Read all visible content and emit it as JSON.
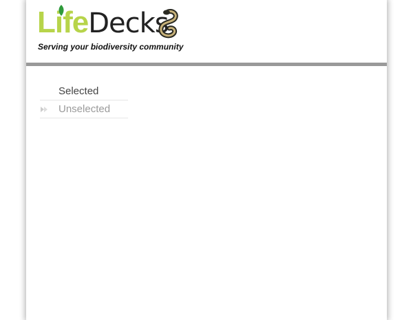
{
  "header": {
    "logo": {
      "part1": "Life",
      "part2": "Decks",
      "icons": [
        "leaf-icon",
        "snake-icon"
      ]
    },
    "tagline": "Serving your biodiversity community"
  },
  "menu": {
    "items": [
      {
        "label": "Selected",
        "state": "selected"
      },
      {
        "label": "Unselected",
        "state": "unselected",
        "icon": "double-arrow-right-icon"
      }
    ]
  },
  "colors": {
    "logo_green": "#b7d44a",
    "logo_dark": "#222222",
    "header_rule": "#999999",
    "selected_text": "#444444",
    "unselected_text": "#9a9a9a"
  }
}
